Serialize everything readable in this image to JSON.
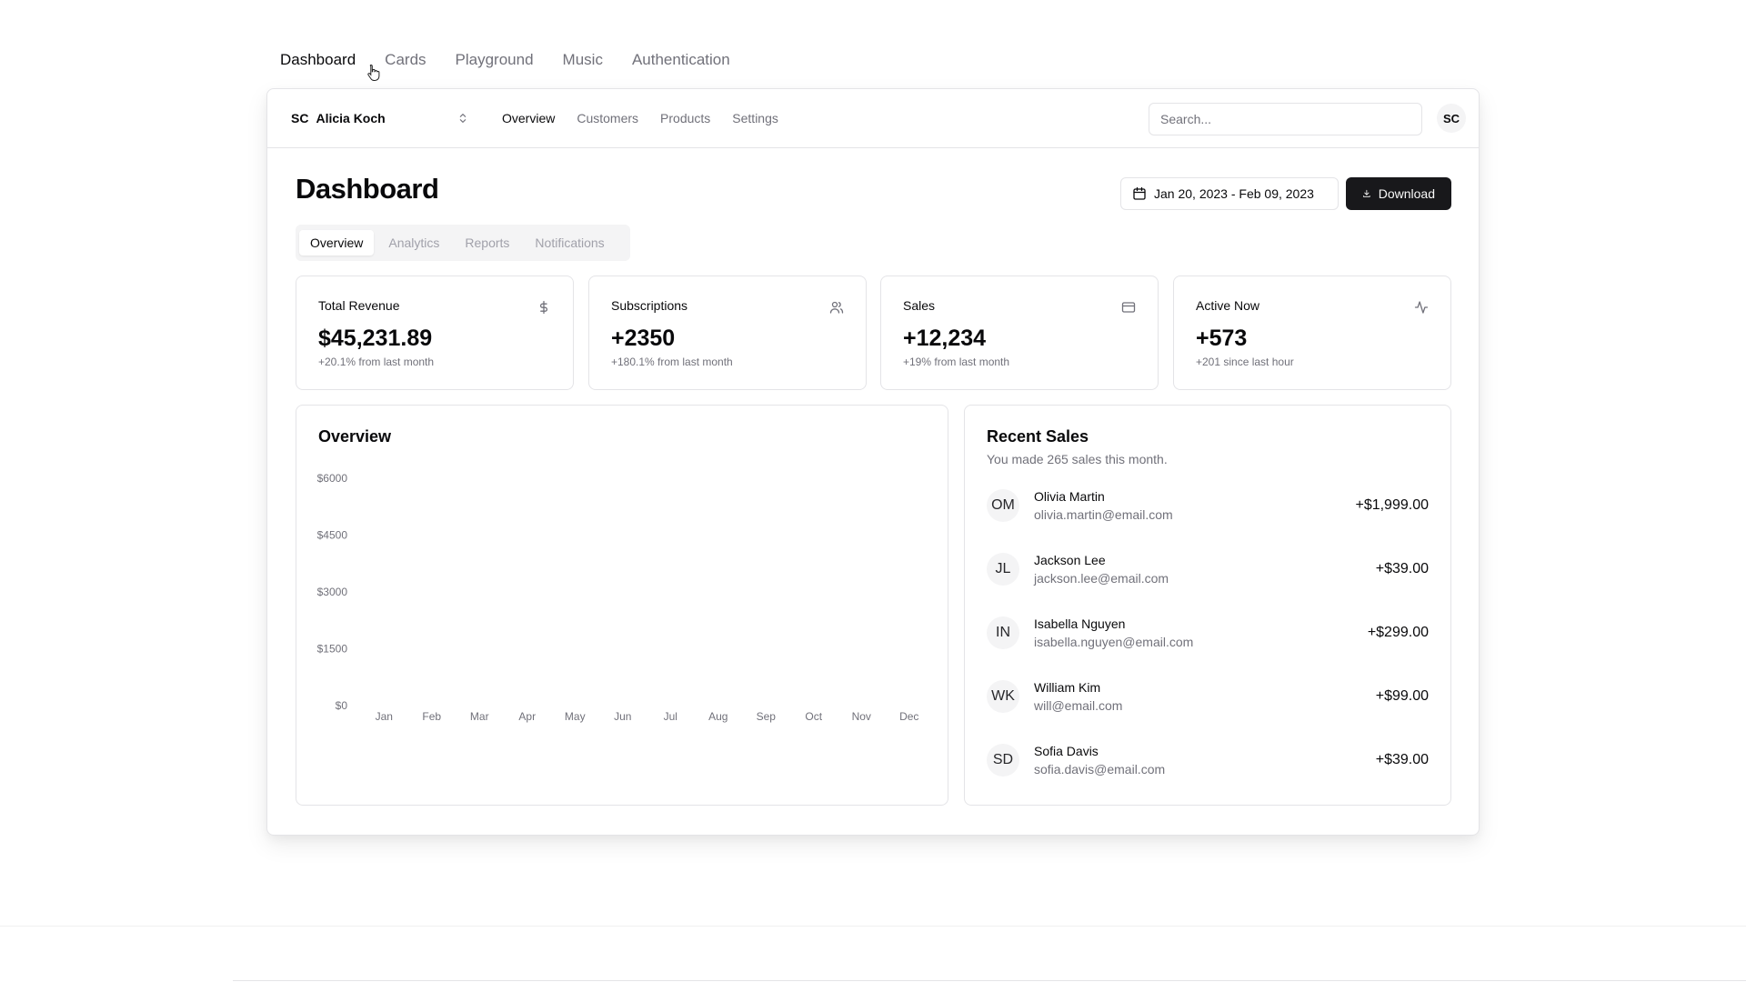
{
  "top_tabs": [
    {
      "label": "Dashboard",
      "active": true
    },
    {
      "label": "Cards",
      "active": false
    },
    {
      "label": "Playground",
      "active": false
    },
    {
      "label": "Music",
      "active": false
    },
    {
      "label": "Authentication",
      "active": false
    }
  ],
  "appbar": {
    "team_initials": "SC",
    "team_name": "Alicia Koch",
    "nav": [
      "Overview",
      "Customers",
      "Products",
      "Settings"
    ],
    "search_placeholder": "Search...",
    "user_initials": "SC"
  },
  "header": {
    "title": "Dashboard",
    "date_range": "Jan 20, 2023 - Feb 09, 2023",
    "download_label": "Download"
  },
  "subtabs": [
    "Overview",
    "Analytics",
    "Reports",
    "Notifications"
  ],
  "stats": [
    {
      "label": "Total Revenue",
      "value": "$45,231.89",
      "sub": "+20.1% from last month",
      "icon": "dollar-icon"
    },
    {
      "label": "Subscriptions",
      "value": "+2350",
      "sub": "+180.1% from last month",
      "icon": "users-icon"
    },
    {
      "label": "Sales",
      "value": "+12,234",
      "sub": "+19% from last month",
      "icon": "credit-card-icon"
    },
    {
      "label": "Active Now",
      "value": "+573",
      "sub": "+201 since last hour",
      "icon": "activity-icon"
    }
  ],
  "overview": {
    "title": "Overview"
  },
  "chart_data": {
    "type": "bar",
    "categories": [
      "Jan",
      "Feb",
      "Mar",
      "Apr",
      "May",
      "Jun",
      "Jul",
      "Aug",
      "Sep",
      "Oct",
      "Nov",
      "Dec"
    ],
    "yticks": [
      "$6000",
      "$4500",
      "$3000",
      "$1500",
      "$0"
    ],
    "ylim": [
      0,
      6000
    ],
    "values": [
      0,
      0,
      0,
      0,
      0,
      0,
      0,
      0,
      0,
      0,
      0,
      0
    ],
    "title": "Overview",
    "grid": false
  },
  "recent_sales": {
    "title": "Recent Sales",
    "subtitle": "You made 265 sales this month.",
    "items": [
      {
        "initials": "OM",
        "name": "Olivia Martin",
        "email": "olivia.martin@email.com",
        "amount": "+$1,999.00"
      },
      {
        "initials": "JL",
        "name": "Jackson Lee",
        "email": "jackson.lee@email.com",
        "amount": "+$39.00"
      },
      {
        "initials": "IN",
        "name": "Isabella Nguyen",
        "email": "isabella.nguyen@email.com",
        "amount": "+$299.00"
      },
      {
        "initials": "WK",
        "name": "William Kim",
        "email": "will@email.com",
        "amount": "+$99.00"
      },
      {
        "initials": "SD",
        "name": "Sofia Davis",
        "email": "sofia.davis@email.com",
        "amount": "+$39.00"
      }
    ]
  }
}
